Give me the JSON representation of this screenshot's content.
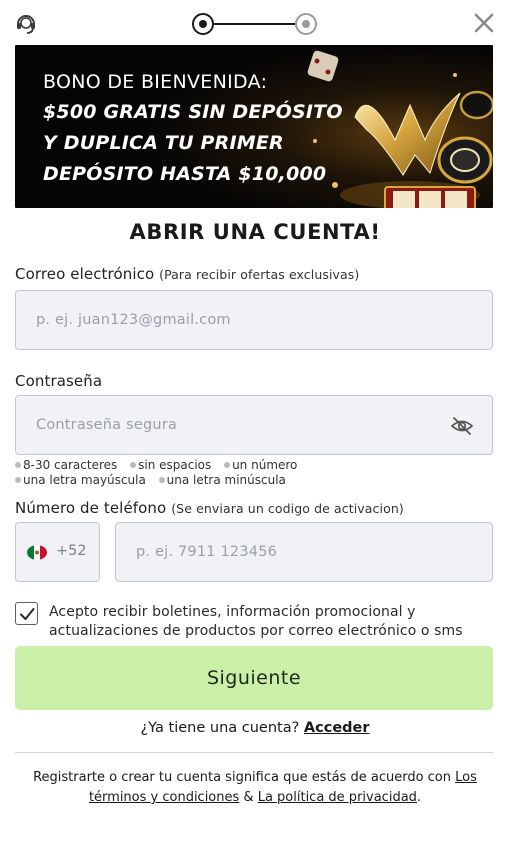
{
  "icons": {
    "support": "headset-support-icon",
    "close": "close-icon",
    "password_visibility": "eye-slash-icon",
    "country_flag": "mexico-flag-icon"
  },
  "progress": {
    "current_step": 1,
    "total_steps": 2
  },
  "banner": {
    "line1": "BONO DE BIENVENIDA:",
    "line2": "$500 GRATIS SIN DEPÓSITO",
    "line3": "Y DUPLICA TU PRIMER",
    "line4": "DEPÓSITO HASTA $10,000"
  },
  "form": {
    "title": "ABRIR UNA CUENTA!",
    "email": {
      "label": "Correo electrónico",
      "sublabel": "(Para recibir ofertas exclusivas)",
      "placeholder": "p. ej. juan123@gmail.com"
    },
    "password": {
      "label": "Contraseña",
      "placeholder": "Contraseña segura",
      "requirements": [
        "8-30 caracteres",
        "sin espacios",
        "un número",
        "una letra mayúscula",
        "una letra minúscula"
      ]
    },
    "phone": {
      "label": "Número de teléfono",
      "sublabel": "(Se enviara un codigo de activacion)",
      "country_code": "+52",
      "placeholder": "p. ej. 7911 123456"
    },
    "consent": {
      "checked": true,
      "text": "Acepto recibir boletines, información promocional y actualizaciones de productos por correo electrónico o sms"
    },
    "submit_label": "Siguiente"
  },
  "login": {
    "prompt": "¿Ya tiene una cuenta?",
    "link": "Acceder"
  },
  "terms": {
    "prefix": "Registrarte o crear tu cuenta significa que estás de acuerdo con",
    "terms_link": "Los términos y condiciones",
    "joiner": "&",
    "privacy_link": "La política de privacidad",
    "suffix": "."
  },
  "colors": {
    "accent_button": "#c9efa9",
    "field_background": "#f1f2f6",
    "banner_gold": "#c79a3c"
  }
}
